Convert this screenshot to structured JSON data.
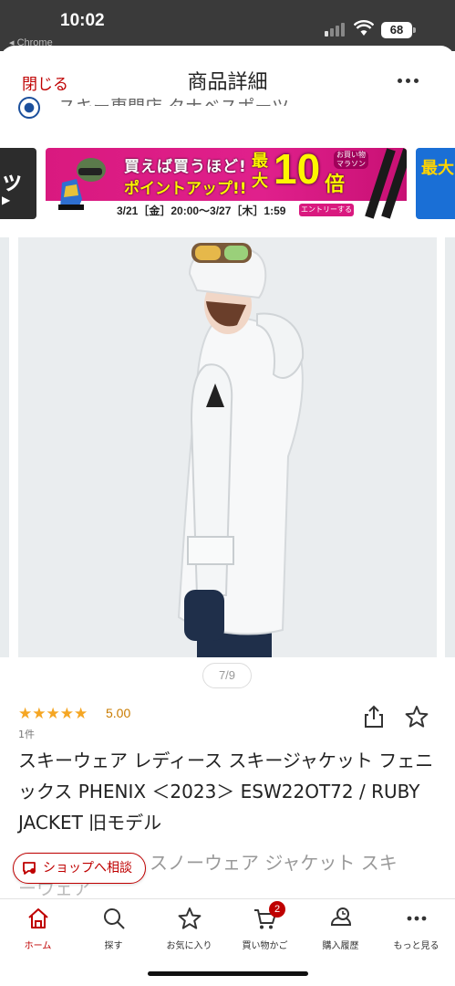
{
  "status_bar": {
    "time": "10:02",
    "back_app": "◂ Chrome",
    "battery": "68"
  },
  "header": {
    "close_label": "閉じる",
    "title": "商品詳細",
    "more_icon": "more-dots-icon"
  },
  "shop": {
    "name_partial": "スキー専門店 タナベスポーツ"
  },
  "banner": {
    "left_text": "ッ",
    "left_sub": "▶",
    "line1": "買えば買うほど!",
    "line2": "ポイントアップ!!",
    "big_prefix": "最大",
    "big_number": "10",
    "big_suffix": "倍",
    "marathon_badge": "お買い物マラソン",
    "dates": "3/21［金］20:00～3/27［木］1:59",
    "entry": "エントリーする▶",
    "right_text": "最大",
    "colors": {
      "pink": "#d9197f",
      "yellow": "#fff600"
    }
  },
  "gallery": {
    "counter": "7/9"
  },
  "product": {
    "stars": "★★★★★",
    "rating": "5.00",
    "reviews": "1件",
    "title": "スキーウェア レディース スキージャケット フェニックス PHENIX ＜2023＞ ESW22OT72 / RUBY JACKET 旧モデル",
    "subtitle_line1": "スノーウェア ジャケット スキ",
    "subtitle_line2": "ーウェア"
  },
  "consult_button": {
    "label": "ショップへ相談"
  },
  "bottom_nav": {
    "items": [
      {
        "label": "ホーム",
        "icon": "home-icon"
      },
      {
        "label": "探す",
        "icon": "search-icon"
      },
      {
        "label": "お気に入り",
        "icon": "star-icon"
      },
      {
        "label": "買い物かご",
        "icon": "cart-icon"
      },
      {
        "label": "購入履歴",
        "icon": "history-icon"
      },
      {
        "label": "もっと見る",
        "icon": "more-dots-icon"
      }
    ],
    "cart_badge": "2",
    "active_color": "#bf0000"
  }
}
